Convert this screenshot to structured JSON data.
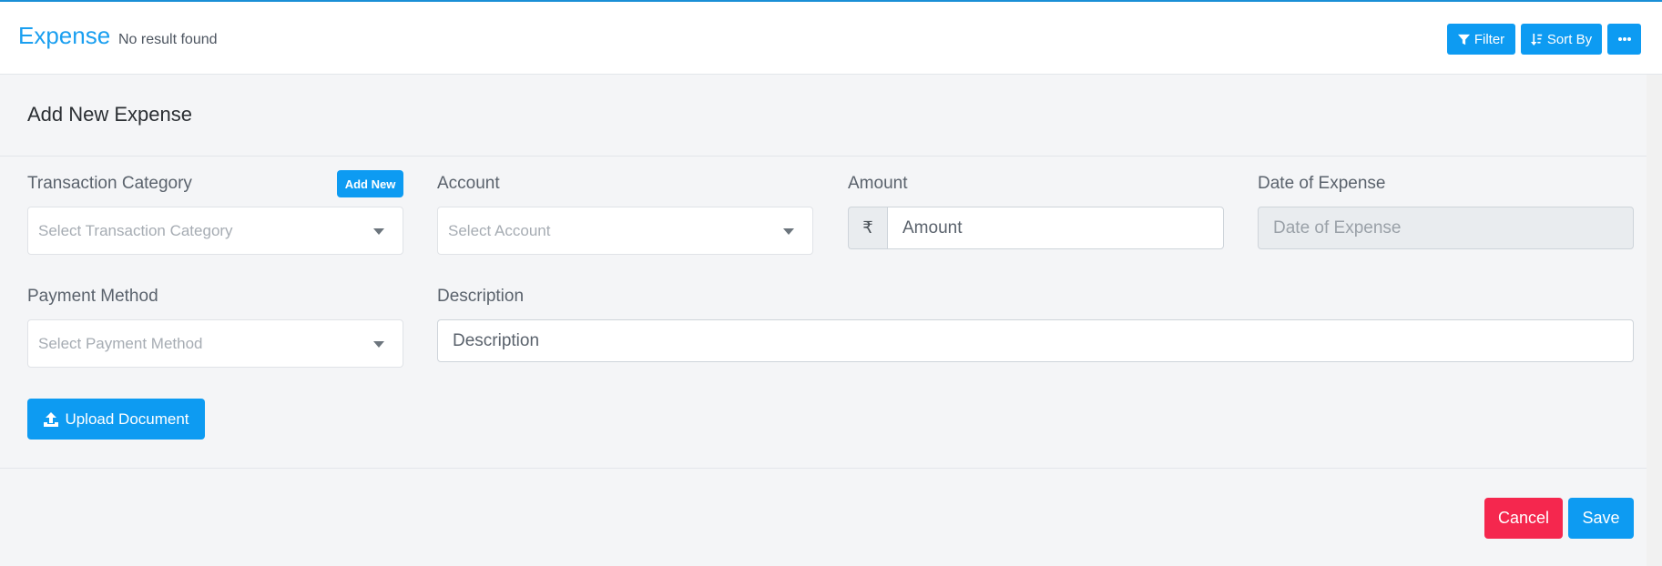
{
  "header": {
    "title": "Expense",
    "subtitle": "No result found",
    "filter_label": "Filter",
    "sort_label": "Sort By",
    "more_icon": "ellipsis-icon"
  },
  "form": {
    "title": "Add New Expense",
    "transaction_category": {
      "label": "Transaction Category",
      "placeholder": "Select Transaction Category",
      "add_new_label": "Add New"
    },
    "account": {
      "label": "Account",
      "placeholder": "Select Account"
    },
    "amount": {
      "label": "Amount",
      "currency_symbol": "₹",
      "placeholder": "Amount"
    },
    "date_of_expense": {
      "label": "Date of Expense",
      "placeholder": "Date of Expense"
    },
    "payment_method": {
      "label": "Payment Method",
      "placeholder": "Select Payment Method"
    },
    "description": {
      "label": "Description",
      "placeholder": "Description"
    },
    "upload_label": "Upload Document"
  },
  "footer": {
    "cancel_label": "Cancel",
    "save_label": "Save"
  },
  "colors": {
    "primary": "#0d9bf2",
    "danger": "#f5274e",
    "title_blue": "#1a9ff0"
  }
}
